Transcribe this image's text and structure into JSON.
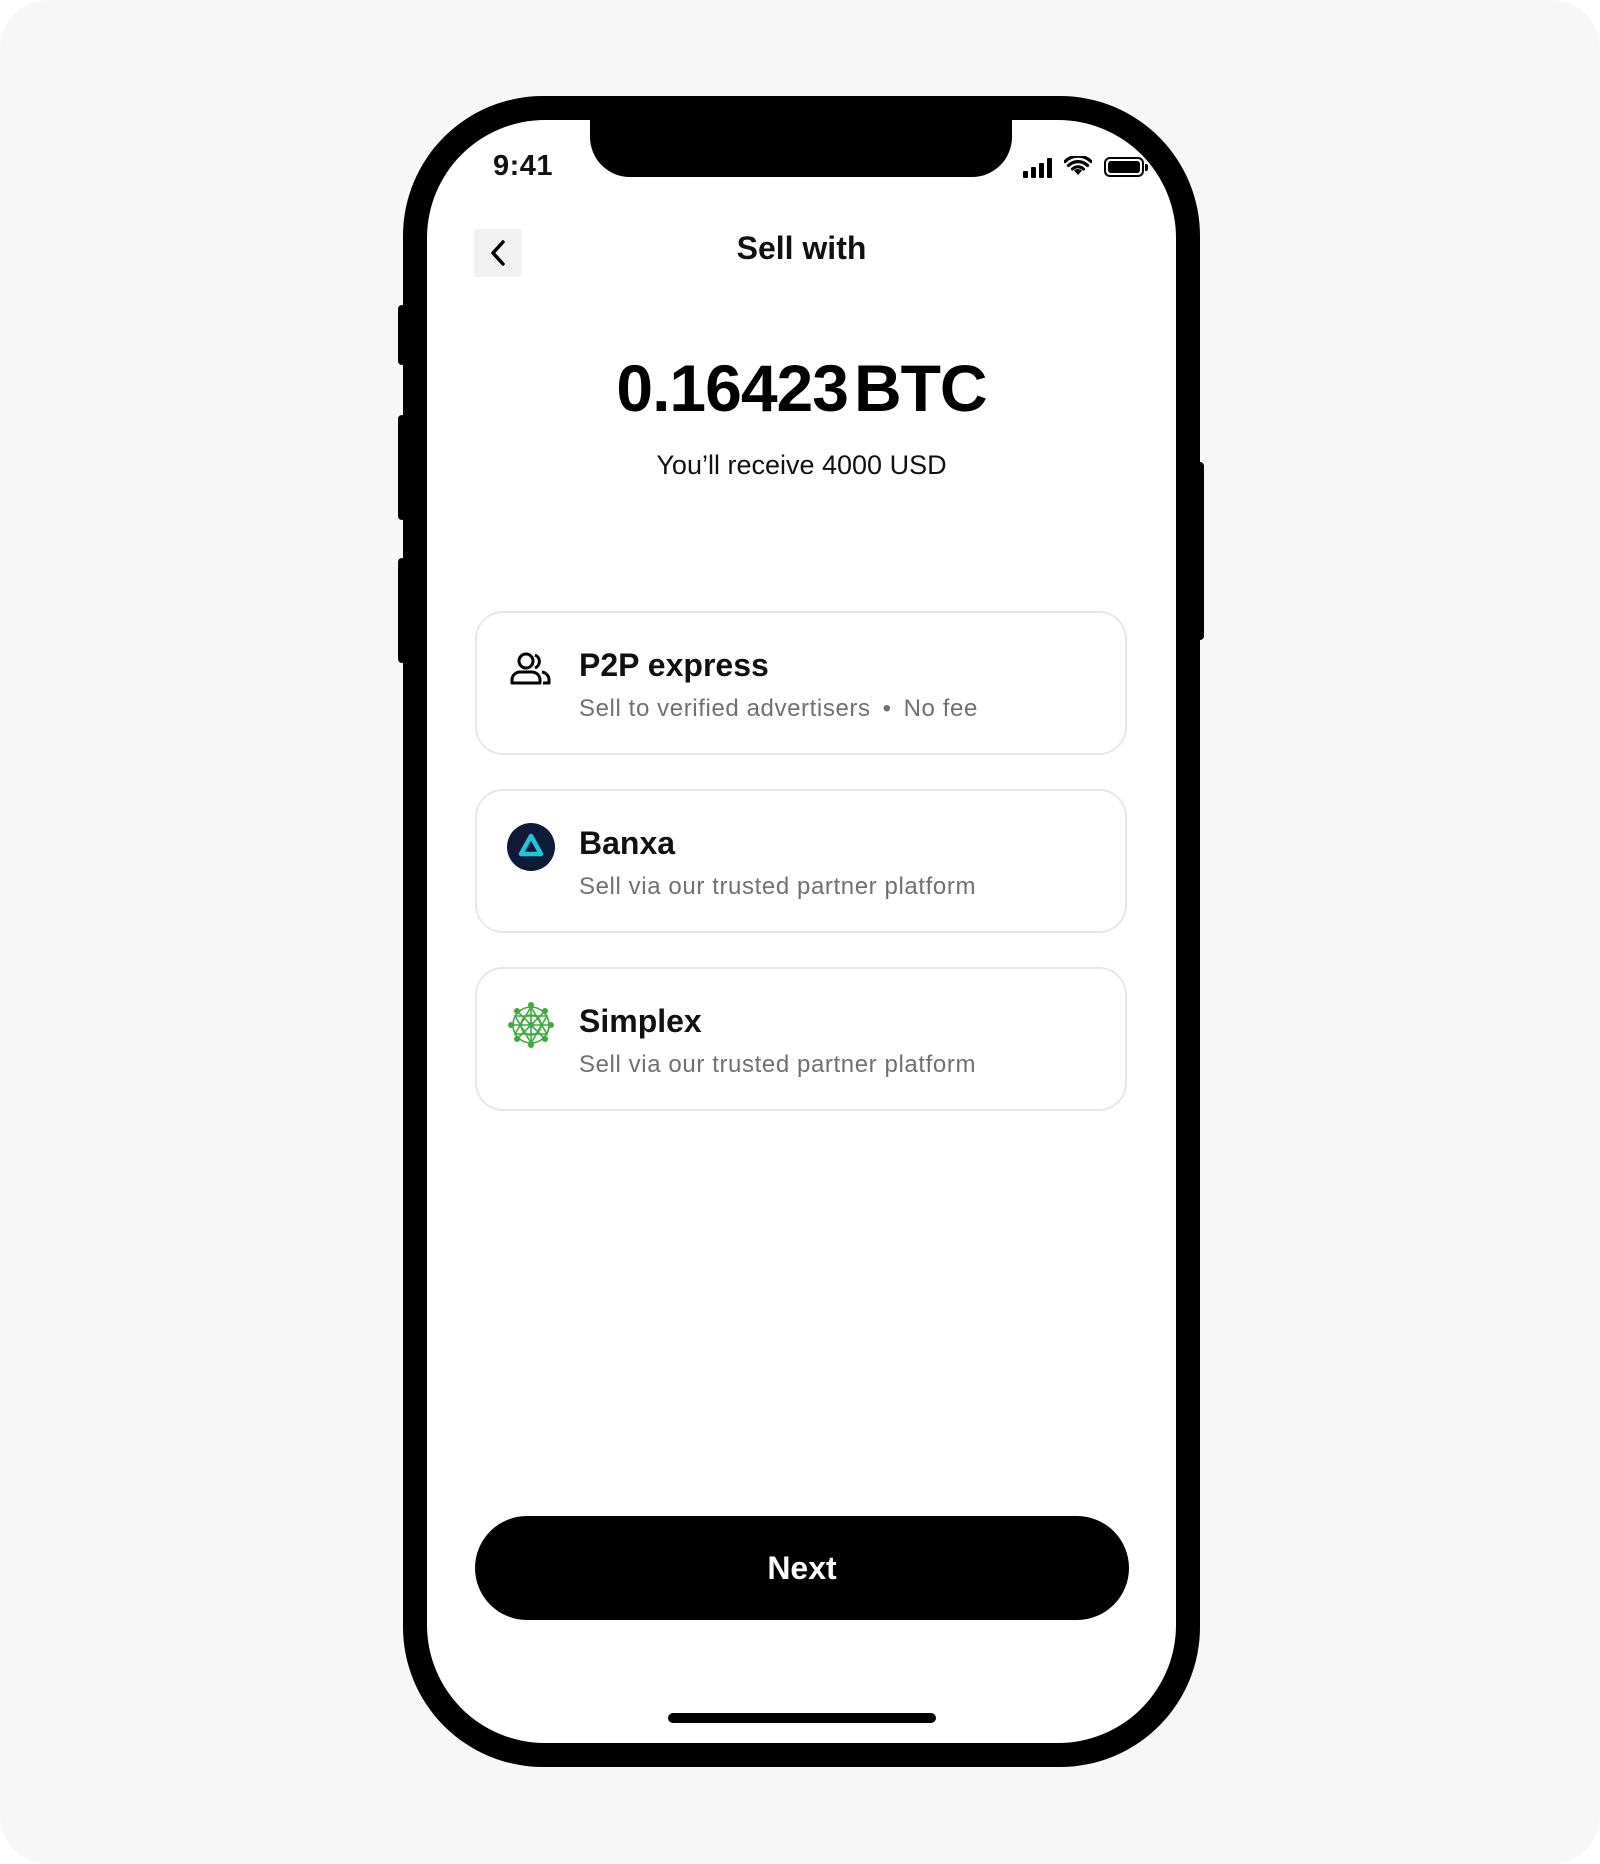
{
  "status_bar": {
    "time": "9:41",
    "icons": [
      "cellular-signal-icon",
      "wifi-icon",
      "battery-icon"
    ]
  },
  "header": {
    "back_icon": "chevron-left-icon",
    "title": "Sell with"
  },
  "amount": {
    "value": "0.16423",
    "unit": "BTC",
    "receive_text": "You’ll receive 4000 USD"
  },
  "options": [
    {
      "icon": "people-icon",
      "title": "P2P express",
      "subtitle": "Sell to verified advertisers",
      "separator": "•",
      "fee": "No fee"
    },
    {
      "icon": "banxa-logo-icon",
      "title": "Banxa",
      "subtitle": "Sell via our trusted partner platform"
    },
    {
      "icon": "simplex-logo-icon",
      "title": "Simplex",
      "subtitle": "Sell via our trusted partner platform"
    }
  ],
  "next_button": {
    "label": "Next"
  },
  "colors": {
    "background": "#f7f7f7",
    "primary": "#000000",
    "secondary_text": "#707070",
    "card_border": "#e8e8e8",
    "banxa_accent": "#1fc7d4",
    "simplex_green": "#3daa3d"
  }
}
